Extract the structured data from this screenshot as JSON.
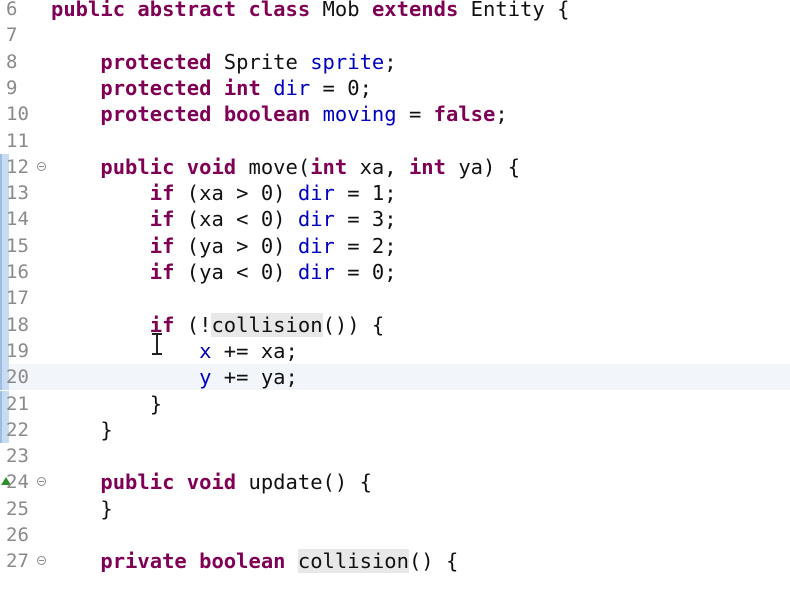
{
  "editor": {
    "lines": [
      {
        "n": "6",
        "code": [
          {
            "t": "kw",
            "v": "public"
          },
          {
            "t": "p",
            "v": " "
          },
          {
            "t": "kw",
            "v": "abstract"
          },
          {
            "t": "p",
            "v": " "
          },
          {
            "t": "kw",
            "v": "class"
          },
          {
            "t": "p",
            "v": " Mob "
          },
          {
            "t": "kw",
            "v": "extends"
          },
          {
            "t": "p",
            "v": " Entity {"
          }
        ]
      },
      {
        "n": "7",
        "code": []
      },
      {
        "n": "8",
        "code": [
          {
            "t": "p",
            "v": "    "
          },
          {
            "t": "kw",
            "v": "protected"
          },
          {
            "t": "p",
            "v": " Sprite "
          },
          {
            "t": "fld",
            "v": "sprite"
          },
          {
            "t": "p",
            "v": ";"
          }
        ]
      },
      {
        "n": "9",
        "code": [
          {
            "t": "p",
            "v": "    "
          },
          {
            "t": "kw",
            "v": "protected"
          },
          {
            "t": "p",
            "v": " "
          },
          {
            "t": "kw",
            "v": "int"
          },
          {
            "t": "p",
            "v": " "
          },
          {
            "t": "fld",
            "v": "dir"
          },
          {
            "t": "p",
            "v": " = 0;"
          }
        ]
      },
      {
        "n": "10",
        "code": [
          {
            "t": "p",
            "v": "    "
          },
          {
            "t": "kw",
            "v": "protected"
          },
          {
            "t": "p",
            "v": " "
          },
          {
            "t": "kw",
            "v": "boolean"
          },
          {
            "t": "p",
            "v": " "
          },
          {
            "t": "fld",
            "v": "moving"
          },
          {
            "t": "p",
            "v": " = "
          },
          {
            "t": "kw",
            "v": "false"
          },
          {
            "t": "p",
            "v": ";"
          }
        ]
      },
      {
        "n": "11",
        "code": []
      },
      {
        "n": "12",
        "fold": true,
        "bar": true,
        "code": [
          {
            "t": "p",
            "v": "    "
          },
          {
            "t": "kw",
            "v": "public"
          },
          {
            "t": "p",
            "v": " "
          },
          {
            "t": "kw",
            "v": "void"
          },
          {
            "t": "p",
            "v": " move("
          },
          {
            "t": "kw",
            "v": "int"
          },
          {
            "t": "p",
            "v": " xa, "
          },
          {
            "t": "kw",
            "v": "int"
          },
          {
            "t": "p",
            "v": " ya) {"
          }
        ]
      },
      {
        "n": "13",
        "bar": true,
        "code": [
          {
            "t": "p",
            "v": "        "
          },
          {
            "t": "kw",
            "v": "if"
          },
          {
            "t": "p",
            "v": " (xa > 0) "
          },
          {
            "t": "fld",
            "v": "dir"
          },
          {
            "t": "p",
            "v": " = 1;"
          }
        ]
      },
      {
        "n": "14",
        "bar": true,
        "code": [
          {
            "t": "p",
            "v": "        "
          },
          {
            "t": "kw",
            "v": "if"
          },
          {
            "t": "p",
            "v": " (xa < 0) "
          },
          {
            "t": "fld",
            "v": "dir"
          },
          {
            "t": "p",
            "v": " = 3;"
          }
        ]
      },
      {
        "n": "15",
        "bar": true,
        "code": [
          {
            "t": "p",
            "v": "        "
          },
          {
            "t": "kw",
            "v": "if"
          },
          {
            "t": "p",
            "v": " (ya > 0) "
          },
          {
            "t": "fld",
            "v": "dir"
          },
          {
            "t": "p",
            "v": " = 2;"
          }
        ]
      },
      {
        "n": "16",
        "bar": true,
        "code": [
          {
            "t": "p",
            "v": "        "
          },
          {
            "t": "kw",
            "v": "if"
          },
          {
            "t": "p",
            "v": " (ya < 0) "
          },
          {
            "t": "fld",
            "v": "dir"
          },
          {
            "t": "p",
            "v": " = 0;"
          }
        ]
      },
      {
        "n": "17",
        "bar": true,
        "code": []
      },
      {
        "n": "18",
        "bar": true,
        "code": [
          {
            "t": "p",
            "v": "        "
          },
          {
            "t": "kw",
            "v": "if"
          },
          {
            "t": "p",
            "v": " (!"
          },
          {
            "t": "occ",
            "v": "collision"
          },
          {
            "t": "p",
            "v": "()) {"
          }
        ]
      },
      {
        "n": "19",
        "bar": true,
        "code": [
          {
            "t": "p",
            "v": "            "
          },
          {
            "t": "fld",
            "v": "x"
          },
          {
            "t": "p",
            "v": " += xa;"
          }
        ]
      },
      {
        "n": "20",
        "bar": true,
        "current": true,
        "code": [
          {
            "t": "p",
            "v": "            "
          },
          {
            "t": "fld",
            "v": "y"
          },
          {
            "t": "p",
            "v": " += ya;"
          }
        ]
      },
      {
        "n": "21",
        "bar": true,
        "code": [
          {
            "t": "p",
            "v": "        }"
          }
        ]
      },
      {
        "n": "22",
        "bar": true,
        "code": [
          {
            "t": "p",
            "v": "    }"
          }
        ]
      },
      {
        "n": "23",
        "code": []
      },
      {
        "n": "24",
        "fold": true,
        "override": true,
        "code": [
          {
            "t": "p",
            "v": "    "
          },
          {
            "t": "kw",
            "v": "public"
          },
          {
            "t": "p",
            "v": " "
          },
          {
            "t": "kw",
            "v": "void"
          },
          {
            "t": "p",
            "v": " update() {"
          }
        ]
      },
      {
        "n": "25",
        "code": [
          {
            "t": "p",
            "v": "    }"
          }
        ]
      },
      {
        "n": "26",
        "code": []
      },
      {
        "n": "27",
        "fold": true,
        "code": [
          {
            "t": "p",
            "v": "    "
          },
          {
            "t": "kw",
            "v": "private"
          },
          {
            "t": "p",
            "v": " "
          },
          {
            "t": "kw",
            "v": "boolean"
          },
          {
            "t": "p",
            "v": " "
          },
          {
            "t": "occ",
            "v": "collision"
          },
          {
            "t": "p",
            "v": "() {"
          }
        ]
      }
    ]
  },
  "cursor": {
    "icon": "text-cursor-icon"
  }
}
